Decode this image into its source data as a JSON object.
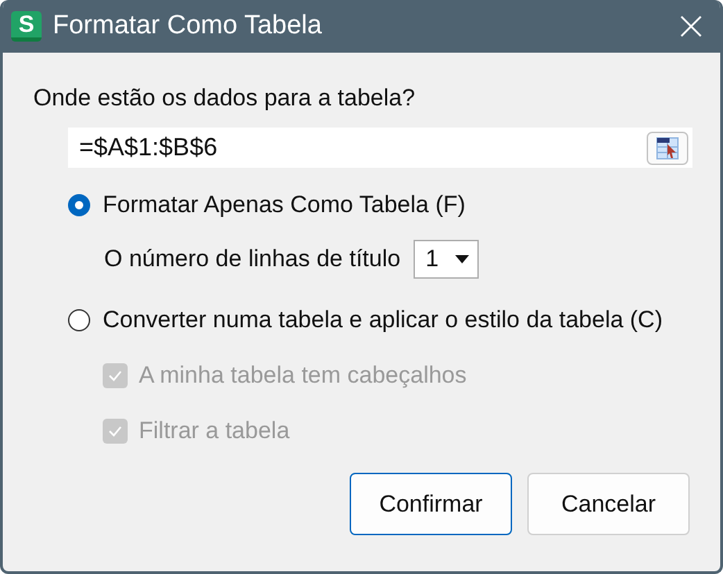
{
  "window": {
    "title": "Formatar Como Tabela",
    "app_icon": "S"
  },
  "range_label": "Onde estão os dados para a tabela?",
  "range_field": {
    "value": "=$A$1:$B$6"
  },
  "options": [
    {
      "label": "Formatar Apenas Como Tabela (F)",
      "selected": true
    },
    {
      "label": "Converter numa tabela e aplicar o estilo da tabela (C)",
      "selected": false
    }
  ],
  "header_rows": {
    "label": "O número de linhas de título",
    "value": "1"
  },
  "checkboxes": [
    {
      "label": "A minha tabela tem cabeçalhos",
      "checked": true,
      "disabled": true
    },
    {
      "label": "Filtrar a tabela",
      "checked": true,
      "disabled": true
    }
  ],
  "buttons": [
    {
      "label": "Confirmar",
      "kind": "primary"
    },
    {
      "label": "Cancelar",
      "kind": "secondary"
    }
  ]
}
